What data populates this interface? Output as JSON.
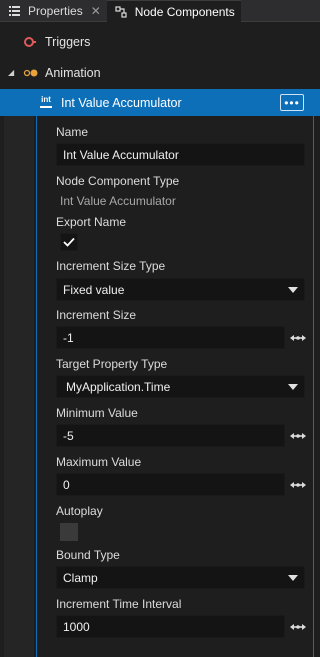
{
  "tabs": [
    {
      "label": "Properties",
      "icon": "list-icon",
      "close": "✕",
      "active": false
    },
    {
      "label": "Node Components",
      "icon": "node-components-icon",
      "active": true
    }
  ],
  "tree": {
    "triggers": {
      "label": "Triggers",
      "icon": "triggers-icon"
    },
    "animation": {
      "label": "Animation",
      "icon": "animation-icon",
      "expander": "◢"
    },
    "component": {
      "label": "Int Value Accumulator",
      "icon_text": "int",
      "more": "•••"
    }
  },
  "properties": {
    "name": {
      "label": "Name",
      "value": "Int Value Accumulator"
    },
    "component_type": {
      "label": "Node Component Type",
      "value": "Int Value Accumulator"
    },
    "export_name": {
      "label": "Export Name",
      "checked": true
    },
    "increment_size_type": {
      "label": "Increment Size Type",
      "value": "Fixed value"
    },
    "increment_size": {
      "label": "Increment Size",
      "value": "-1"
    },
    "target_property_type": {
      "label": "Target Property Type",
      "value": "MyApplication.Time"
    },
    "minimum_value": {
      "label": "Minimum Value",
      "value": "-5"
    },
    "maximum_value": {
      "label": "Maximum Value",
      "value": "0"
    },
    "autoplay": {
      "label": "Autoplay",
      "checked": false
    },
    "bound_type": {
      "label": "Bound Type",
      "value": "Clamp"
    },
    "increment_time_interval": {
      "label": "Increment Time Interval",
      "value": "1000"
    }
  },
  "colors": {
    "accent": "#0d6fb8",
    "background": "#1e1e1e",
    "field": "#141414",
    "trigger_icon": "#e05a5a",
    "animation_icon": "#e8a33c"
  }
}
